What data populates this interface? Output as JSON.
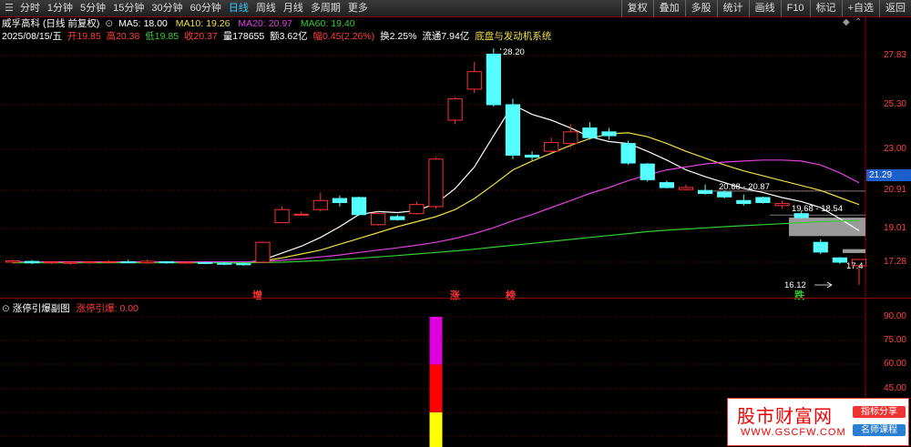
{
  "toolbar": {
    "menu_icon": "☰",
    "period_tabs": [
      "分时",
      "1分钟",
      "5分钟",
      "15分钟",
      "30分钟",
      "60分钟",
      "日线",
      "周线",
      "月线",
      "多周期",
      "更多"
    ],
    "tools": [
      "复权",
      "叠加",
      "多股",
      "统计",
      "画线",
      "F10",
      "标记",
      "+自选",
      "返回"
    ]
  },
  "header": {
    "security_name": "威孚高科",
    "period_label": "(日线 前复权)"
  },
  "indicators": {
    "ma5_label": "MA5:",
    "ma5": "18.00",
    "ma10_label": "MA10:",
    "ma10": "19.26",
    "ma20_label": "MA20:",
    "ma20": "20.97",
    "ma60_label": "MA60:",
    "ma60": "19.40"
  },
  "quote": {
    "date": "2025/08/15/五",
    "open_label": "开",
    "open": "19.85",
    "high_label": "高",
    "high": "20.38",
    "low_label": "低",
    "low": "19.85",
    "close_label": "收",
    "close": "20.37",
    "vol_label": "量",
    "vol": "178655",
    "amt_label": "额",
    "amt": "3.62亿",
    "chg_label": "幅",
    "chg": "0.45(2.26%)",
    "turnover": "换2.25%",
    "float_cap": "流通7.94亿",
    "sector": "底盘与发动机系统"
  },
  "price_axis": [
    "27.83",
    "25.30",
    "23.00",
    "20.91",
    "19.01",
    "17.28"
  ],
  "current_price": "21.29",
  "annotations": {
    "peak": "28.20",
    "low_a": "17.4",
    "low_b": "16.12",
    "band_a": "20.68 - 20.87",
    "band_b": "19.68 - 18.54"
  },
  "events": [
    {
      "text": "增",
      "color": "#ff3232"
    },
    {
      "text": "涨",
      "color": "#ff3232"
    },
    {
      "text": "榜",
      "color": "#ff3232"
    },
    {
      "text": "跌",
      "color": "#33cc33"
    }
  ],
  "indicator_panel": {
    "name": "涨停引爆副图",
    "value_label": "涨停引爆: 0.00",
    "axis": [
      "90.00",
      "75.00",
      "60.00",
      "45.00",
      "30.00",
      "15.00"
    ]
  },
  "watermark": {
    "title": "股市财富网",
    "url": "WWW.GSCFW.COM",
    "pill1": "指标分享",
    "pill2": "名师课程"
  },
  "chart_data": [
    {
      "type": "candlestick",
      "title": "威孚高科",
      "ylim": [
        15.8,
        28.6
      ],
      "candles": [
        {
          "o": 17.28,
          "c": 17.35,
          "h": 17.4,
          "l": 17.2
        },
        {
          "o": 17.32,
          "c": 17.25,
          "h": 17.38,
          "l": 17.18
        },
        {
          "o": 17.25,
          "c": 17.3,
          "h": 17.34,
          "l": 17.18
        },
        {
          "o": 17.22,
          "c": 17.28,
          "h": 17.32,
          "l": 17.15
        },
        {
          "o": 17.28,
          "c": 17.3,
          "h": 17.35,
          "l": 17.2
        },
        {
          "o": 17.28,
          "c": 17.31,
          "h": 17.38,
          "l": 17.22
        },
        {
          "o": 17.3,
          "c": 17.28,
          "h": 17.4,
          "l": 17.22
        },
        {
          "o": 17.25,
          "c": 17.33,
          "h": 17.42,
          "l": 17.2
        },
        {
          "o": 17.3,
          "c": 17.26,
          "h": 17.34,
          "l": 17.2
        },
        {
          "o": 17.24,
          "c": 17.28,
          "h": 17.3,
          "l": 17.2
        },
        {
          "o": 17.26,
          "c": 17.22,
          "h": 17.3,
          "l": 17.18
        },
        {
          "o": 17.22,
          "c": 17.18,
          "h": 17.28,
          "l": 17.12
        },
        {
          "o": 17.2,
          "c": 17.15,
          "h": 17.25,
          "l": 17.1
        },
        {
          "o": 17.28,
          "c": 18.3,
          "h": 18.32,
          "l": 17.25
        },
        {
          "o": 19.3,
          "c": 19.95,
          "h": 20.1,
          "l": 19.28
        },
        {
          "o": 19.7,
          "c": 19.72,
          "h": 19.85,
          "l": 19.65
        },
        {
          "o": 19.95,
          "c": 20.4,
          "h": 20.8,
          "l": 19.85
        },
        {
          "o": 20.5,
          "c": 20.3,
          "h": 20.65,
          "l": 20.1
        },
        {
          "o": 20.55,
          "c": 19.7,
          "h": 20.6,
          "l": 19.65
        },
        {
          "o": 19.2,
          "c": 19.75,
          "h": 19.85,
          "l": 19.15
        },
        {
          "o": 19.6,
          "c": 19.45,
          "h": 19.7,
          "l": 19.4
        },
        {
          "o": 19.75,
          "c": 20.2,
          "h": 20.35,
          "l": 19.7
        },
        {
          "o": 20.1,
          "c": 22.5,
          "h": 22.6,
          "l": 20.0
        },
        {
          "o": 24.5,
          "c": 25.6,
          "h": 25.7,
          "l": 24.3
        },
        {
          "o": 26.1,
          "c": 27.0,
          "h": 27.5,
          "l": 25.9
        },
        {
          "o": 27.9,
          "c": 25.3,
          "h": 28.2,
          "l": 25.2
        },
        {
          "o": 25.3,
          "c": 22.7,
          "h": 25.6,
          "l": 22.5
        },
        {
          "o": 22.7,
          "c": 22.6,
          "h": 22.9,
          "l": 22.45
        },
        {
          "o": 22.9,
          "c": 23.35,
          "h": 23.6,
          "l": 22.8
        },
        {
          "o": 23.3,
          "c": 23.9,
          "h": 24.3,
          "l": 23.1
        },
        {
          "o": 24.1,
          "c": 23.6,
          "h": 24.4,
          "l": 23.5
        },
        {
          "o": 23.9,
          "c": 23.7,
          "h": 24.1,
          "l": 23.5
        },
        {
          "o": 23.3,
          "c": 22.3,
          "h": 23.45,
          "l": 22.2
        },
        {
          "o": 22.25,
          "c": 21.45,
          "h": 22.3,
          "l": 21.35
        },
        {
          "o": 21.3,
          "c": 21.05,
          "h": 21.4,
          "l": 21.0
        },
        {
          "o": 20.95,
          "c": 21.05,
          "h": 21.2,
          "l": 20.9
        },
        {
          "o": 20.9,
          "c": 20.75,
          "h": 21.2,
          "l": 20.7
        },
        {
          "o": 20.82,
          "c": 20.58,
          "h": 20.9,
          "l": 20.5
        },
        {
          "o": 20.4,
          "c": 20.25,
          "h": 20.7,
          "l": 20.15
        },
        {
          "o": 20.55,
          "c": 20.3,
          "h": 20.6,
          "l": 20.25
        },
        {
          "o": 20.15,
          "c": 20.25,
          "h": 20.4,
          "l": 20.0
        },
        {
          "o": 19.75,
          "c": 19.55,
          "h": 19.9,
          "l": 19.5
        },
        {
          "o": 18.3,
          "c": 17.8,
          "h": 18.45,
          "l": 17.7
        },
        {
          "o": 17.5,
          "c": 17.28,
          "h": 17.55,
          "l": 17.2
        },
        {
          "o": 17.1,
          "c": 17.42,
          "h": 17.45,
          "l": 16.12
        }
      ],
      "series": [
        {
          "name": "MA5",
          "color": "#ffffff",
          "values": [
            17.28,
            17.29,
            17.3,
            17.29,
            17.29,
            17.29,
            17.3,
            17.3,
            17.29,
            17.28,
            17.27,
            17.25,
            17.23,
            17.4,
            17.75,
            18.1,
            18.55,
            19.1,
            19.7,
            19.85,
            19.8,
            19.9,
            20.25,
            21.0,
            22.1,
            23.7,
            25.3,
            24.8,
            24.5,
            24.1,
            23.65,
            23.4,
            23.3,
            22.9,
            22.45,
            21.95,
            21.6,
            21.3,
            21.0,
            20.8,
            20.55,
            20.35,
            20.05,
            19.5,
            18.9
          ]
        },
        {
          "name": "MA10",
          "color": "#f0e040",
          "values": [
            17.29,
            17.29,
            17.29,
            17.29,
            17.29,
            17.29,
            17.29,
            17.29,
            17.29,
            17.29,
            17.28,
            17.27,
            17.26,
            17.35,
            17.5,
            17.7,
            17.9,
            18.2,
            18.5,
            18.8,
            19.1,
            19.35,
            19.6,
            19.95,
            20.5,
            21.2,
            21.95,
            22.4,
            22.8,
            23.2,
            23.55,
            23.8,
            23.85,
            23.65,
            23.3,
            22.9,
            22.55,
            22.2,
            21.9,
            21.65,
            21.4,
            21.15,
            20.9,
            20.55,
            20.2
          ]
        },
        {
          "name": "MA20",
          "color": "#e040e0",
          "values": [
            17.3,
            17.3,
            17.3,
            17.3,
            17.3,
            17.3,
            17.3,
            17.3,
            17.3,
            17.3,
            17.3,
            17.3,
            17.3,
            17.32,
            17.38,
            17.45,
            17.55,
            17.65,
            17.78,
            17.9,
            18.02,
            18.15,
            18.3,
            18.5,
            18.75,
            19.05,
            19.4,
            19.7,
            20.05,
            20.4,
            20.75,
            21.05,
            21.4,
            21.7,
            21.95,
            22.1,
            22.25,
            22.35,
            22.4,
            22.45,
            22.45,
            22.4,
            22.2,
            21.8,
            21.29
          ]
        },
        {
          "name": "MA60",
          "color": "#33cc33",
          "values": [
            17.25,
            17.25,
            17.25,
            17.25,
            17.25,
            17.25,
            17.25,
            17.25,
            17.25,
            17.25,
            17.25,
            17.25,
            17.25,
            17.26,
            17.28,
            17.32,
            17.36,
            17.42,
            17.48,
            17.55,
            17.62,
            17.7,
            17.78,
            17.86,
            17.95,
            18.05,
            18.15,
            18.25,
            18.35,
            18.45,
            18.55,
            18.65,
            18.75,
            18.85,
            18.92,
            18.98,
            19.04,
            19.1,
            19.15,
            19.2,
            19.25,
            19.3,
            19.35,
            19.38,
            19.4
          ]
        }
      ]
    },
    {
      "type": "bar",
      "title": "涨停引爆副图",
      "ylim": [
        0,
        90
      ],
      "bar_index": 22,
      "segments": [
        {
          "from": 0,
          "to": 30,
          "color": "#ffff00"
        },
        {
          "from": 30,
          "to": 60,
          "color": "#ff0000"
        },
        {
          "from": 60,
          "to": 90,
          "color": "#dd00dd"
        }
      ]
    }
  ]
}
